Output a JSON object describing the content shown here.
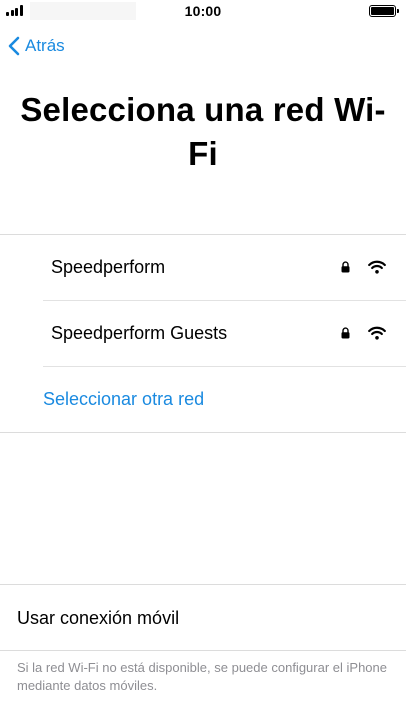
{
  "status_bar": {
    "time": "10:00",
    "signal_bars": 4,
    "battery_level": 1.0
  },
  "nav": {
    "back_label": "Atrás"
  },
  "title": "Selecciona una red Wi-Fi",
  "networks": [
    {
      "name": "Speedperform",
      "locked": true,
      "signal_icon": "wifi-icon"
    },
    {
      "name": "Speedperform Guests",
      "locked": true,
      "signal_icon": "wifi-icon"
    }
  ],
  "other_network_label": "Seleccionar otra red",
  "cellular_option_label": "Usar conexión móvil",
  "footer_note": "Si la red Wi-Fi no está disponible, se puede configurar el iPhone mediante datos móviles.",
  "colors": {
    "accent": "#1a8ae0",
    "secondary_text": "#8e8e93",
    "separator": "#dcdcdc"
  }
}
